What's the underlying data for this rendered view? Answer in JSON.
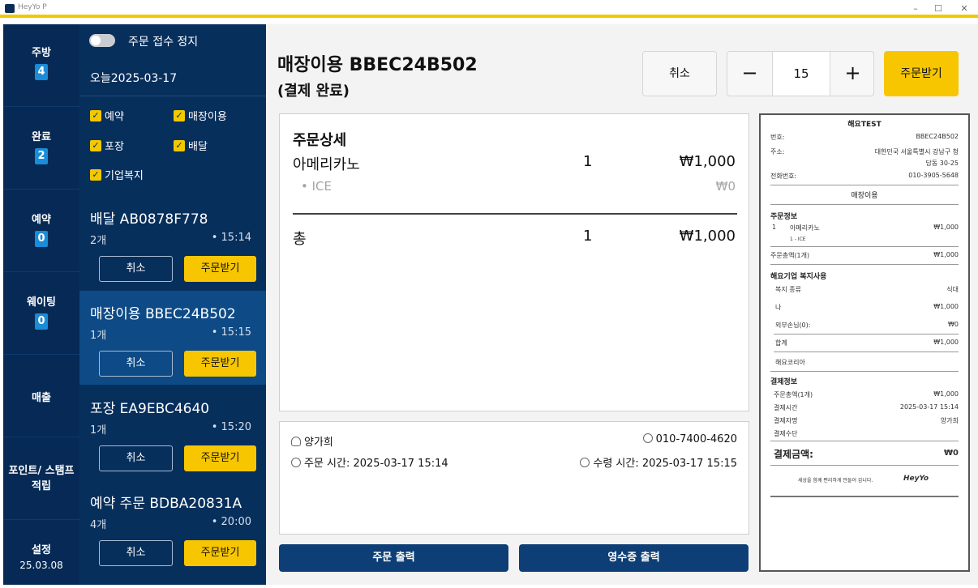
{
  "window": {
    "title": "HeyYo P",
    "controls": [
      "–",
      "☐",
      "✕"
    ]
  },
  "nav": {
    "items": [
      {
        "label": "주방",
        "badge": "4"
      },
      {
        "label": "완료",
        "badge": "2"
      },
      {
        "label": "예약",
        "badge": "0"
      },
      {
        "label": "웨이팅",
        "badge": "0"
      }
    ],
    "sales": "매출",
    "points": "포인트/ 스탬프 적립",
    "settings": "설정",
    "version": "25.03.08"
  },
  "order_list": {
    "stop_toggle_label": "주문 접수 정지",
    "date": "오늘2025-03-17",
    "filters": [
      "예약",
      "매장이용",
      "포장",
      "배달",
      "기업복지"
    ],
    "cancel_label": "취소",
    "accept_label": "주문받기",
    "orders": [
      {
        "title": "배달 AB0878F778",
        "count": "2개",
        "time": "• 15:14"
      },
      {
        "title": "매장이용 BBEC24B502",
        "count": "1개",
        "time": "• 15:15"
      },
      {
        "title": "포장 EA9EBC4640",
        "count": "1개",
        "time": "• 15:20"
      },
      {
        "title": "예약 주문 BDBA20831A",
        "count": "4개",
        "time": "• 20:00"
      }
    ]
  },
  "main": {
    "title": "매장이용 BBEC24B502",
    "status": "(결제 완료)",
    "cancel": "취소",
    "qty": "15",
    "minus": "−",
    "plus": "+",
    "accept": "주문받기",
    "detail": {
      "heading": "주문상세",
      "item_name": "아메리카노",
      "item_qty": "1",
      "item_price": "₩1,000",
      "option": "• ICE",
      "option_price": "₩0",
      "total_label": "총",
      "total_qty": "1",
      "total_price": "₩1,000"
    },
    "info": {
      "customer": "양가희",
      "phone": "010-7400-4620",
      "order_time": "주문 시간: 2025-03-17 15:14",
      "pickup_time": "수령 시간: 2025-03-17 15:15"
    },
    "print_order": "주문 출력",
    "print_receipt": "영수증 출력"
  },
  "receipt": {
    "store": "해요TEST",
    "no_label": "번호:",
    "no": "BBEC24B502",
    "addr_label": "주소:",
    "addr1": "대한민국 서울특별시 강남구 청",
    "addr2": "담동 30-25",
    "phone_label": "전화번호:",
    "phone": "010-3905-5648",
    "type": "매장이용",
    "order_info": "주문정보",
    "item_qty": "1",
    "item_name": "아메리카노",
    "item_price": "₩1,000",
    "item_opt": "1 - ICE",
    "order_total_label": "주문총액(1개)",
    "order_total": "₩1,000",
    "welfare_title": "해요기업 복지사용",
    "welfare_kind_label": "복지 종류",
    "welfare_kind": "식대",
    "me_label": "나",
    "me": "₩1,000",
    "guest_label": "외부손님(0):",
    "guest": "₩0",
    "sum_label": "합계",
    "sum": "₩1,000",
    "corp": "해요코리아",
    "pay_title": "결제정보",
    "pay_total_label": "주문총액(1개)",
    "pay_total": "₩1,000",
    "pay_time_label": "결제시간",
    "pay_time": "2025-03-17 15:14",
    "payer_label": "결제자명",
    "payer": "양가희",
    "method_label": "결제수단",
    "amount_label": "결제금액:",
    "amount": "₩0",
    "footer": "세상을 함께 편리하게 만들어 갑니다.",
    "brand": "HeyYo"
  }
}
